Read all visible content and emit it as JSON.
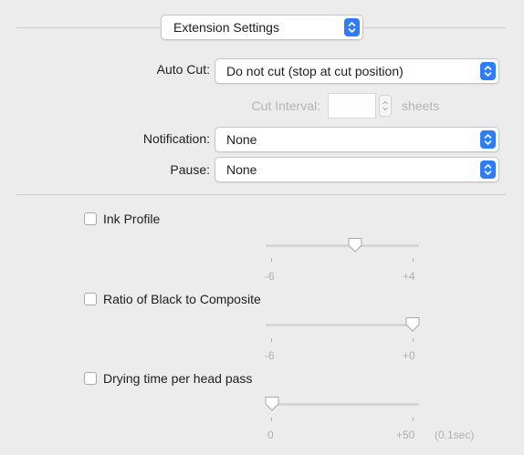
{
  "header": {
    "title": "Extension Settings"
  },
  "auto_cut": {
    "label": "Auto Cut:",
    "value": "Do not cut (stop at cut position)",
    "interval_label": "Cut Interval:",
    "interval_value": "",
    "interval_unit": "sheets"
  },
  "notification": {
    "label": "Notification:",
    "value": "None"
  },
  "pause": {
    "label": "Pause:",
    "value": "None"
  },
  "ink_profile": {
    "label": "Ink Profile",
    "checked": false,
    "min_label": "-6",
    "max_label": "+4",
    "slider_value": 0
  },
  "black_ratio": {
    "label": "Ratio of Black to Composite",
    "checked": false,
    "min_label": "-6",
    "max_label": "+0",
    "slider_value": 0
  },
  "drying_time": {
    "label": "Drying time per head pass",
    "checked": false,
    "min_label": "0",
    "max_label": "+50",
    "unit": "(0.1sec)",
    "slider_value": 0
  },
  "colors": {
    "accent": "#2f7df6",
    "background": "#ececec"
  }
}
